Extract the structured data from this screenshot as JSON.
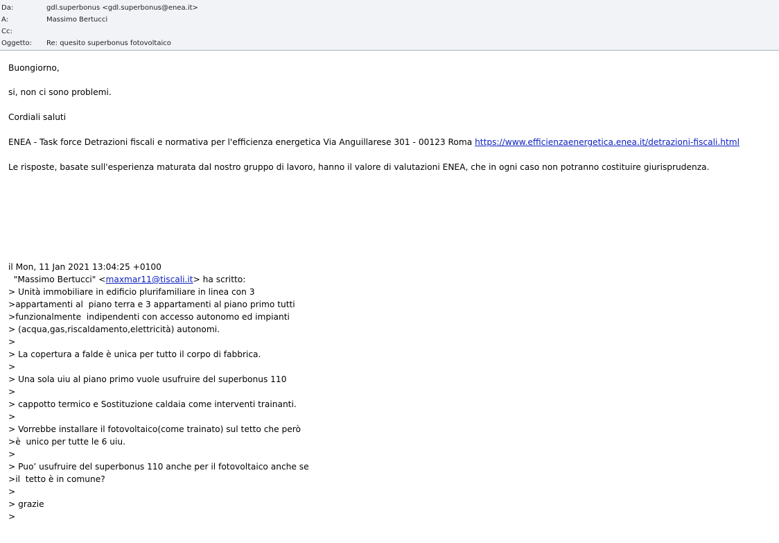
{
  "header": {
    "from_label": "Da:",
    "from_value": "gdl.superbonus <gdl.superbonus@enea.it>",
    "to_label": "A:",
    "to_value": "Massimo Bertucci",
    "cc_label": "Cc:",
    "cc_value": "",
    "subject_label": "Oggetto:",
    "subject_value": "Re: quesito superbonus fotovoltaico"
  },
  "reply": {
    "greeting": "Buongiorno,",
    "answer": "si, non ci sono problemi.",
    "closing": "Cordiali saluti",
    "signature_text": "ENEA - Task force Detrazioni fiscali e normativa per l'efficienza energetica Via Anguillarese 301 - 00123 Roma ",
    "signature_link": "https://www.efficienzaenergetica.enea.it/detrazioni-fiscali.html",
    "disclaimer": "Le risposte, basate sull'esperienza maturata dal nostro gruppo di lavoro,  hanno il valore di valutazioni ENEA, che in ogni caso non potranno costituire giurisprudenza."
  },
  "quoted": {
    "date_line": "il Mon, 11 Jan 2021 13:04:25 +0100",
    "author_prefix": "  \"Massimo Bertucci\" <",
    "author_email": "maxmar11@tiscali.it",
    "author_suffix": "> ha scritto:",
    "lines": [
      "> Unità immobiliare in edificio plurifamiliare in linea con 3",
      ">appartamenti al  piano terra e 3 appartamenti al piano primo tutti",
      ">funzionalmente  indipendenti con accesso autonomo ed impianti",
      "> (acqua,gas,riscaldamento,elettricità) autonomi.",
      ">",
      "> La copertura a falde è unica per tutto il corpo di fabbrica.",
      ">",
      "> Una sola uiu al piano primo vuole usufruire del superbonus 110",
      ">",
      "> cappotto termico e Sostituzione caldaia come interventi trainanti.",
      ">",
      "> Vorrebbe installare il fotovoltaico(come trainato) sul tetto che però",
      ">è  unico per tutte le 6 uiu.",
      ">",
      "> Puo’ usufruire del superbonus 110 anche per il fotovoltaico anche se",
      ">il  tetto è in comune?",
      ">",
      "> grazie",
      ">"
    ]
  }
}
